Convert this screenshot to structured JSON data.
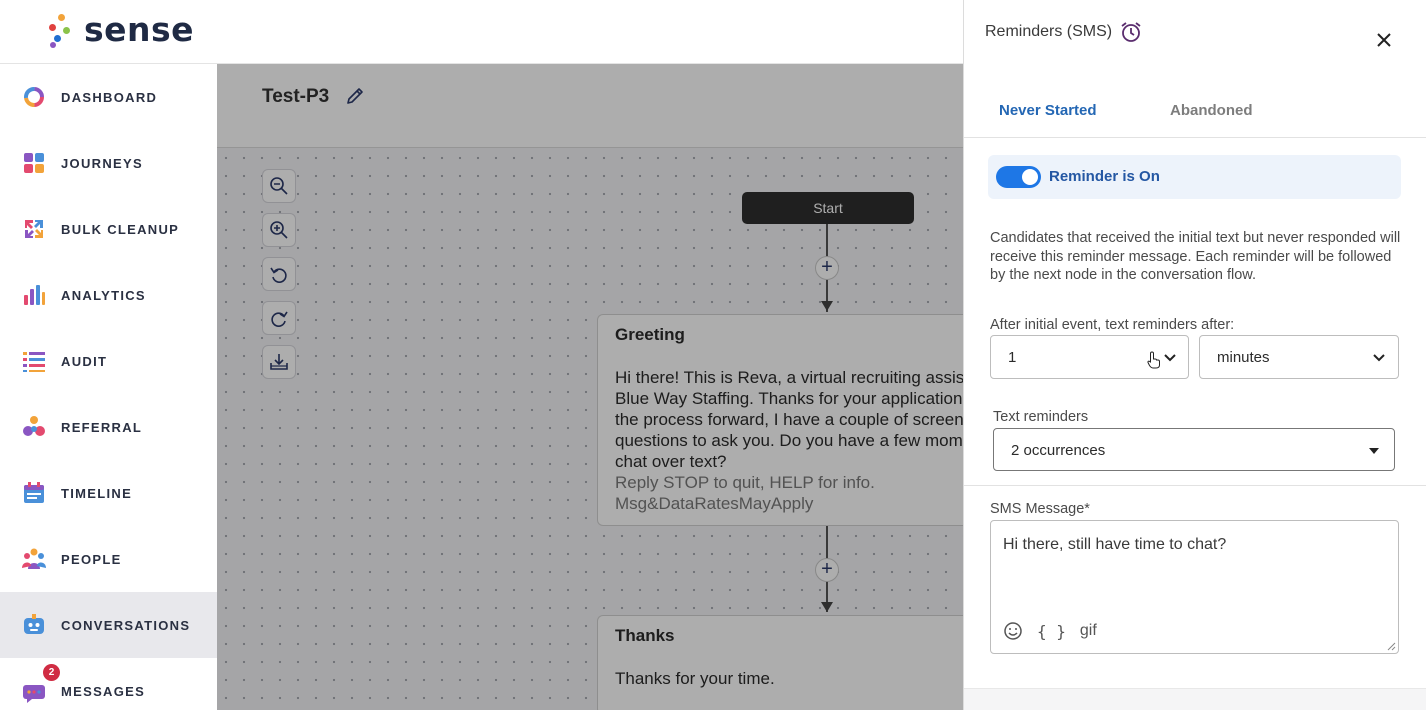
{
  "brand": {
    "name": "sense"
  },
  "sidebar": {
    "items": [
      {
        "label": "DASHBOARD",
        "icon": "dashboard-ring-icon"
      },
      {
        "label": "JOURNEYS",
        "icon": "journeys-grid-icon"
      },
      {
        "label": "BULK CLEANUP",
        "icon": "bulk-cleanup-icon"
      },
      {
        "label": "ANALYTICS",
        "icon": "analytics-bars-icon"
      },
      {
        "label": "AUDIT",
        "icon": "audit-list-icon"
      },
      {
        "label": "REFERRAL",
        "icon": "referral-icon"
      },
      {
        "label": "TIMELINE",
        "icon": "timeline-calendar-icon"
      },
      {
        "label": "PEOPLE",
        "icon": "people-icon"
      },
      {
        "label": "CONVERSATIONS",
        "icon": "conversations-bot-icon"
      },
      {
        "label": "MESSAGES",
        "icon": "messages-chat-icon",
        "badge": "2"
      }
    ],
    "active": "CONVERSATIONS"
  },
  "canvas": {
    "flow_title": "Test-P3",
    "start_label": "Start",
    "nodes": [
      {
        "title": "Greeting",
        "lines": [
          "Hi there! This is Reva, a virtual recruiting assis",
          "Blue Way Staffing. Thanks for your application",
          "the process forward, I have a couple of screen",
          "questions to ask you. Do you have a few mom",
          "chat over text?"
        ],
        "footer_lines": [
          "Reply STOP to quit, HELP for info.",
          "Msg&DataRatesMayApply"
        ]
      },
      {
        "title": "Thanks",
        "lines": [
          "Thanks for your time."
        ]
      }
    ]
  },
  "drawer": {
    "title": "Reminders (SMS)",
    "tabs": [
      "Never Started",
      "Abandoned"
    ],
    "active_tab": "Never Started",
    "toggle": {
      "label": "Reminder is On",
      "on": true
    },
    "description": "Candidates that received the initial text but never responded will receive this reminder message. Each reminder will be followed by the next node in the conversation flow.",
    "after_label": "After initial event, text reminders after:",
    "after_value": "1",
    "after_unit": "minutes",
    "reminders_label": "Text reminders",
    "reminders_value": "2 occurrences",
    "sms_label": "SMS Message*",
    "sms_value": "Hi there, still have time to chat?",
    "gif_label": "gif",
    "braces_label": "{ }"
  },
  "colors": {
    "accent_blue": "#1e77e6",
    "tab_active": "#2467b4",
    "badge_red": "#d02c43",
    "nav_active_bg": "#e8e8ec"
  }
}
